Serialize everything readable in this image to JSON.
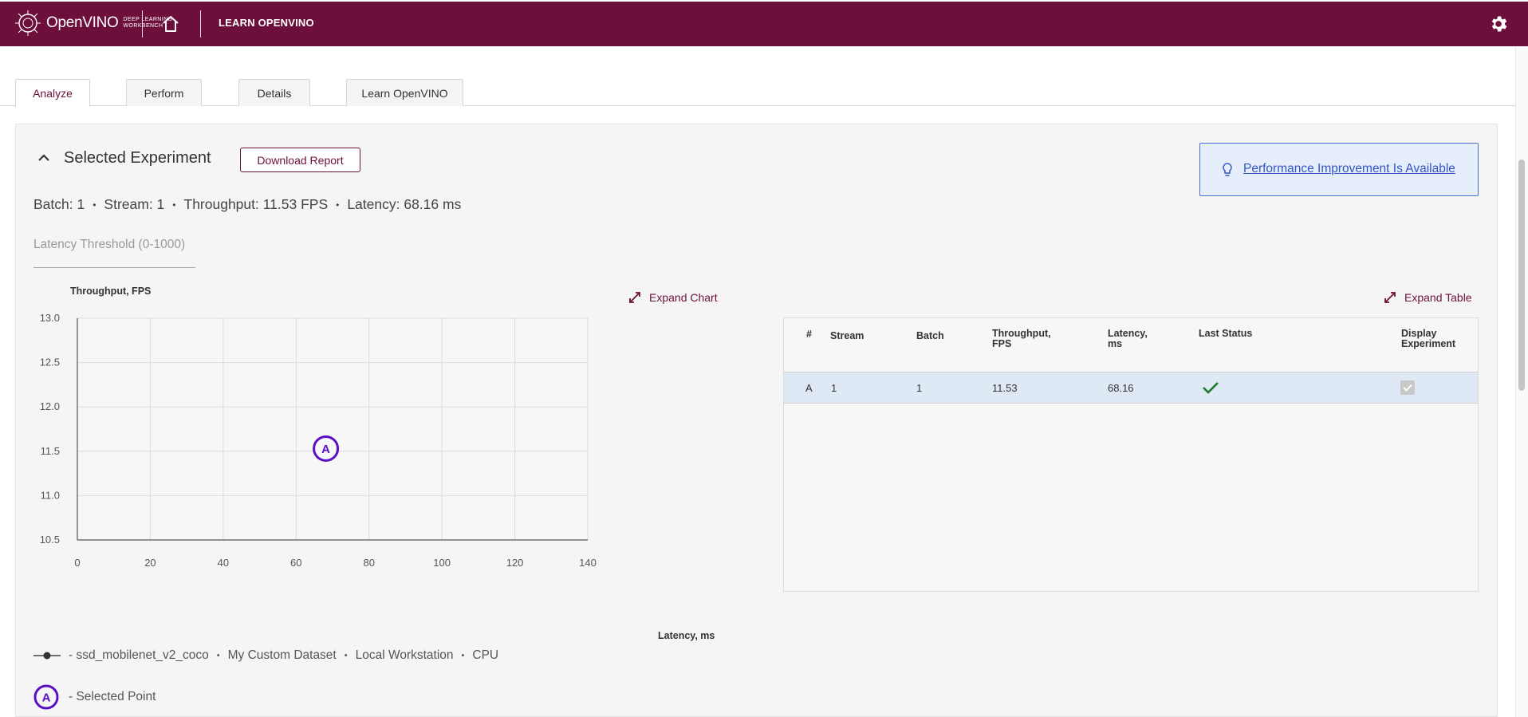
{
  "header": {
    "logo_brand": "OpenVINO",
    "logo_sub_1": "DEEP LEARNING",
    "logo_sub_2": "WORKBENCH",
    "title": "LEARN OPENVINO"
  },
  "tabs": [
    {
      "label": "Analyze",
      "active": true
    },
    {
      "label": "Perform",
      "active": false
    },
    {
      "label": "Details",
      "active": false
    },
    {
      "label": "Learn OpenVINO",
      "active": false
    }
  ],
  "experiment": {
    "section_title": "Selected Experiment",
    "download_label": "Download Report",
    "perf_link": "Performance Improvement Is Available",
    "batch": "Batch: 1",
    "stream": "Stream: 1",
    "throughput": "Throughput: 11.53 FPS",
    "latency": "Latency: 68.16 ms",
    "threshold_placeholder": "Latency Threshold (0-1000)"
  },
  "chart_labels": {
    "expand_chart": "Expand Chart",
    "expand_table": "Expand Table"
  },
  "chart_data": {
    "type": "scatter",
    "xlabel": "Latency, ms",
    "ylabel": "Throughput, FPS",
    "xlim": [
      0,
      140
    ],
    "ylim": [
      10.5,
      13.0
    ],
    "x_ticks": [
      0,
      20,
      40,
      60,
      80,
      100,
      120,
      140
    ],
    "y_ticks": [
      "13.0",
      "12.5",
      "12.0",
      "11.5",
      "11.0",
      "10.5"
    ],
    "grid": true,
    "points": [
      {
        "label": "A",
        "x": 68.16,
        "y": 11.53
      }
    ],
    "point_color": "#5b0fc2"
  },
  "legend": {
    "model": "- ssd_mobilenet_v2_coco",
    "dataset": "My Custom Dataset",
    "target": "Local Workstation",
    "device": "CPU",
    "selected_point_letter": "A",
    "selected_point": "- Selected Point"
  },
  "table": {
    "headers": {
      "num": "#",
      "stream": "Stream",
      "batch": "Batch",
      "throughput_1": "Throughput,",
      "throughput_2": "FPS",
      "latency_1": "Latency,",
      "latency_2": "ms",
      "status": "Last Status",
      "display_1": "Display",
      "display_2": "Experiment"
    },
    "rows": [
      {
        "num": "A",
        "stream": "1",
        "batch": "1",
        "throughput": "11.53",
        "latency": "68.16",
        "status": "success",
        "display": true
      }
    ]
  },
  "colors": {
    "brand": "#6d0f3b",
    "link": "#3155c3",
    "selected_point": "#5b0fc2",
    "success": "#1e7a2e"
  }
}
